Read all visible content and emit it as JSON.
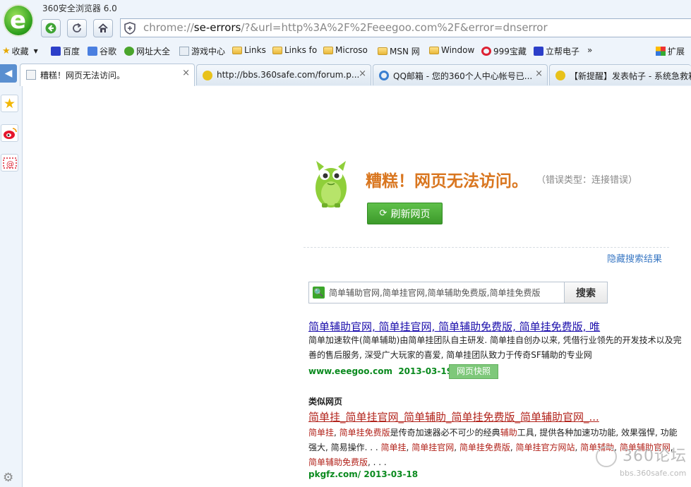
{
  "window": {
    "title": "360安全浏览器 6.0"
  },
  "address_bar": {
    "prefix": "chrome://",
    "host": "se-errors",
    "rest": "/?&url=http%3A%2F%2Feeegoo.com%2F&error=dnserror"
  },
  "bookmarks": {
    "favorites": "收藏",
    "items": [
      "百度",
      "谷歌",
      "网址大全",
      "游戏中心",
      "Links",
      "Links fo",
      "Microso",
      "MSN 网",
      "Window",
      "999宝藏",
      "立帮电子"
    ],
    "more": "»",
    "extensions": "扩展"
  },
  "tabs": [
    {
      "label": "糟糕！网页无法访问。",
      "close": "×"
    },
    {
      "label": "http://bbs.360safe.com/forum.p...",
      "close": "×"
    },
    {
      "label": "QQ邮箱 - 您的360个人中心帐号已...",
      "close": "×"
    },
    {
      "label": "【新提醒】发表帖子 - 系统急救箱"
    }
  ],
  "error": {
    "title": "糟糕！网页无法访问。",
    "type": "（错误类型：连接错误）",
    "refresh_label": "刷新网页"
  },
  "hide_results": "隐藏搜索结果",
  "search": {
    "value": "简单辅助官网,简单挂官网,简单辅助免费版,简单挂免费版",
    "button": "搜索"
  },
  "result": {
    "title": "简单辅助官网, 简单挂官网, 简单辅助免费版, 简单挂免费版, 唯",
    "desc": "简单加速软件(简单辅助)由简单挂团队自主研发. 简单挂自创办以来, 凭借行业领先的开发技术以及完善的售后服务, 深受广大玩家的喜爱, 简单挂团队致力于传奇SF辅助的专业网",
    "url": "www.eeegoo.com",
    "date": "2013-03-19",
    "snapshot": "网页快照"
  },
  "similar": {
    "heading": "类似网页",
    "title": "简单挂_简单挂官网_简单辅助_简单挂免费版_简单辅助官网_...",
    "desc_parts": [
      {
        "t": "简单挂",
        "hl": true
      },
      {
        "t": ", ",
        "hl": false
      },
      {
        "t": "简单挂免费版",
        "hl": true
      },
      {
        "t": "是传奇加速器必不可少的经典",
        "hl": false
      },
      {
        "t": "辅助",
        "hl": true
      },
      {
        "t": "工具, 提供各种加速功功能, 效果强悍, 功能强大, 简易操作. . . ",
        "hl": false
      },
      {
        "t": "简单挂",
        "hl": true
      },
      {
        "t": ", ",
        "hl": false
      },
      {
        "t": "简单挂官网",
        "hl": true
      },
      {
        "t": ", ",
        "hl": false
      },
      {
        "t": "简单挂免费版",
        "hl": true
      },
      {
        "t": ", ",
        "hl": false
      },
      {
        "t": "简单挂官方网站",
        "hl": true
      },
      {
        "t": ", ",
        "hl": false
      },
      {
        "t": "简单辅助",
        "hl": true
      },
      {
        "t": ", ",
        "hl": false
      },
      {
        "t": "简单辅助官网",
        "hl": true
      },
      {
        "t": ", ",
        "hl": false
      },
      {
        "t": "简单辅助免费版",
        "hl": true
      },
      {
        "t": ", . . .",
        "hl": false
      }
    ],
    "url": "pkgfz.com/",
    "date": "2013-03-18"
  },
  "watermark": {
    "big": "360论坛",
    "small": "bbs.360safe.com"
  },
  "icons": {
    "logo": "360-browser-logo",
    "back": "back-arrow-icon",
    "refresh": "refresh-icon",
    "home": "home-icon",
    "shield": "shield-icon",
    "star": "star-icon",
    "weibo": "weibo-icon",
    "mail": "mail-icon",
    "gear": "gear-icon"
  },
  "colors": {
    "error_orange": "#d9761f",
    "button_green": "#3c9a2a",
    "link_blue": "#1a0dab",
    "url_green": "#0a8a1e",
    "highlight_red": "#b2231b"
  }
}
